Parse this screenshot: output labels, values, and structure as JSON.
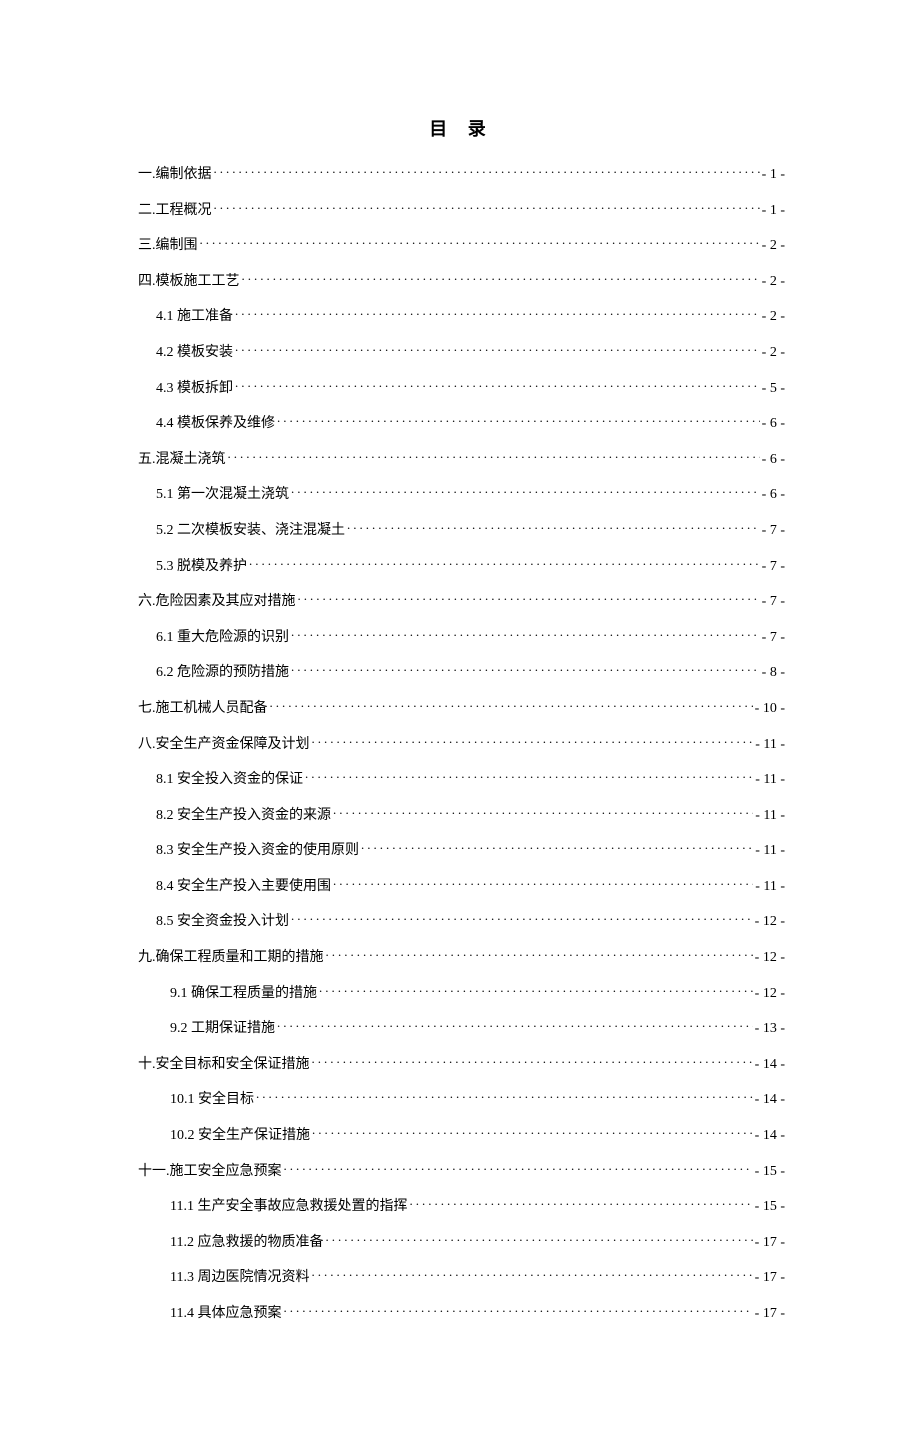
{
  "title": "目 录",
  "entries": [
    {
      "label": "一.编制依据",
      "page": "- 1 -",
      "indent": 0
    },
    {
      "label": "二.工程概况",
      "page": "- 1 -",
      "indent": 0
    },
    {
      "label": "三.编制围",
      "page": "- 2 -",
      "indent": 0
    },
    {
      "label": "四.模板施工工艺",
      "page": "- 2 -",
      "indent": 0
    },
    {
      "label": "4.1 施工准备",
      "page": "- 2 -",
      "indent": 1
    },
    {
      "label": "4.2 模板安装",
      "page": "- 2 -",
      "indent": 1
    },
    {
      "label": "4.3 模板拆卸",
      "page": "- 5 -",
      "indent": 1
    },
    {
      "label": "4.4 模板保养及维修",
      "page": "- 6 -",
      "indent": 1
    },
    {
      "label": "五.混凝土浇筑",
      "page": "- 6 -",
      "indent": 0
    },
    {
      "label": "5.1 第一次混凝土浇筑",
      "page": "- 6 -",
      "indent": 1
    },
    {
      "label": "5.2 二次模板安装、浇注混凝土",
      "page": "- 7 -",
      "indent": 1
    },
    {
      "label": "5.3 脱模及养护",
      "page": "- 7 -",
      "indent": 1
    },
    {
      "label": "六.危险因素及其应对措施",
      "page": "- 7 -",
      "indent": 0
    },
    {
      "label": "6.1 重大危险源的识别",
      "page": "- 7 -",
      "indent": 1
    },
    {
      "label": "6.2 危险源的预防措施",
      "page": "- 8 -",
      "indent": 1
    },
    {
      "label": "七.施工机械人员配备",
      "page": "- 10 -",
      "indent": 0
    },
    {
      "label": "八.安全生产资金保障及计划",
      "page": "- 11 -",
      "indent": 0
    },
    {
      "label": "8.1 安全投入资金的保证",
      "page": "- 11 -",
      "indent": 1
    },
    {
      "label": "8.2 安全生产投入资金的来源",
      "page": "- 11 -",
      "indent": 1
    },
    {
      "label": "8.3 安全生产投入资金的使用原则",
      "page": "- 11 -",
      "indent": 1
    },
    {
      "label": "8.4 安全生产投入主要使用围",
      "page": "- 11 -",
      "indent": 1
    },
    {
      "label": "8.5 安全资金投入计划",
      "page": "- 12 -",
      "indent": 1
    },
    {
      "label": "九.确保工程质量和工期的措施",
      "page": "- 12 -",
      "indent": 0
    },
    {
      "label": "9.1 确保工程质量的措施",
      "page": "- 12 -",
      "indent": 2
    },
    {
      "label": "9.2 工期保证措施",
      "page": "- 13 -",
      "indent": 2
    },
    {
      "label": "十.安全目标和安全保证措施",
      "page": "- 14 -",
      "indent": 0
    },
    {
      "label": "10.1 安全目标",
      "page": "- 14 -",
      "indent": 2
    },
    {
      "label": "10.2 安全生产保证措施",
      "page": "- 14 -",
      "indent": 2
    },
    {
      "label": "十一.施工安全应急预案",
      "page": "- 15 -",
      "indent": 0
    },
    {
      "label": "11.1 生产安全事故应急救援处置的指挥",
      "page": "- 15 -",
      "indent": 2
    },
    {
      "label": "11.2 应急救援的物质准备",
      "page": "- 17 -",
      "indent": 2
    },
    {
      "label": "11.3 周边医院情况资料",
      "page": "- 17 -",
      "indent": 2
    },
    {
      "label": "11.4 具体应急预案",
      "page": "- 17 -",
      "indent": 2
    }
  ]
}
